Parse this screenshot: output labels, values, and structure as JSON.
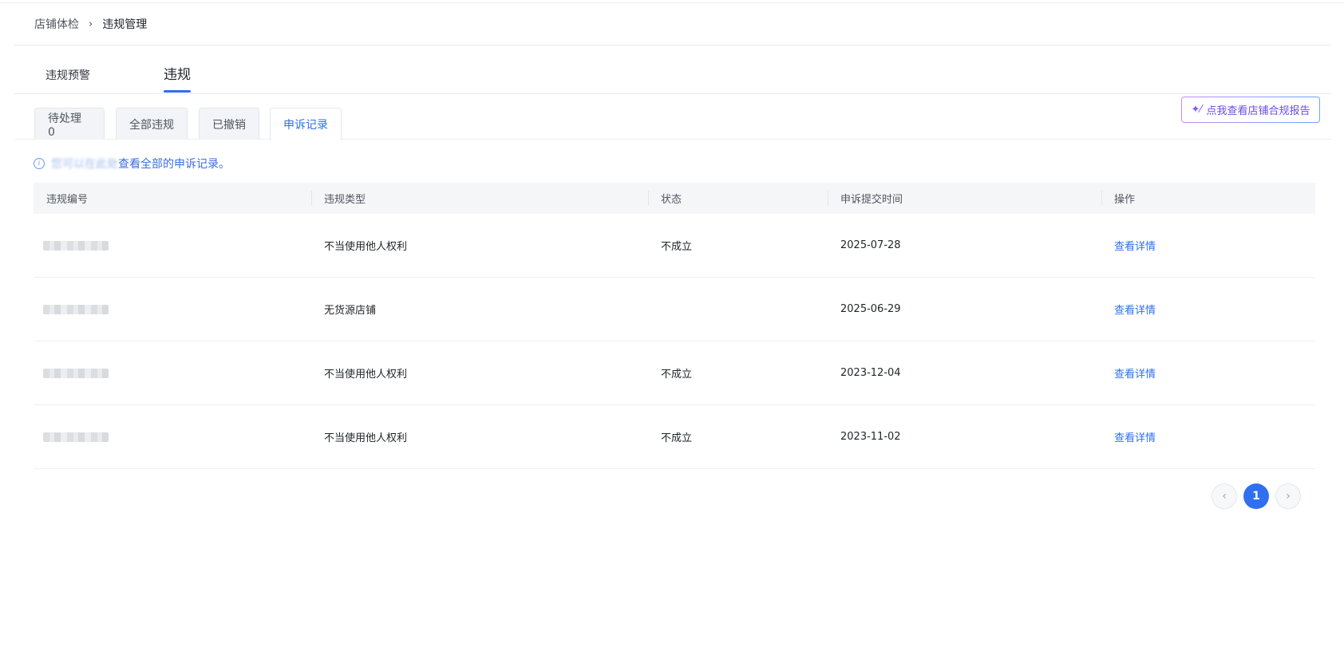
{
  "breadcrumb": {
    "parent": "店铺体检",
    "separator": "›",
    "current": "违规管理"
  },
  "main_tabs": [
    {
      "label": "违规预警"
    },
    {
      "label": "违规"
    }
  ],
  "sub_tabs": [
    {
      "label": "待处理 0"
    },
    {
      "label": "全部违规"
    },
    {
      "label": "已撤销"
    },
    {
      "label": "申诉记录"
    }
  ],
  "report_button": {
    "icon": "sparkle-icon",
    "icon_glyph": "✦⁄",
    "label": "点我查看店铺合规报告"
  },
  "info": {
    "icon_glyph": "i",
    "text_blurred": "您可以在此处",
    "text": "查看全部的申诉记录。"
  },
  "table": {
    "columns": [
      "违规编号",
      "违规类型",
      "状态",
      "申诉提交时间",
      "操作"
    ],
    "rows": [
      {
        "type": "不当使用他人权利",
        "status": "不成立",
        "time": "2025-07-28",
        "action": "查看详情"
      },
      {
        "type": "无货源店铺",
        "status": "",
        "time": "2025-06-29",
        "action": "查看详情"
      },
      {
        "type": "不当使用他人权利",
        "status": "不成立",
        "time": "2023-12-04",
        "action": "查看详情"
      },
      {
        "type": "不当使用他人权利",
        "status": "不成立",
        "time": "2023-11-02",
        "action": "查看详情"
      }
    ]
  },
  "pagination": {
    "prev": "‹",
    "current_page": "1",
    "next": "›"
  },
  "colors": {
    "accent": "#2f6ff0",
    "header_bg": "#f5f6f8"
  }
}
